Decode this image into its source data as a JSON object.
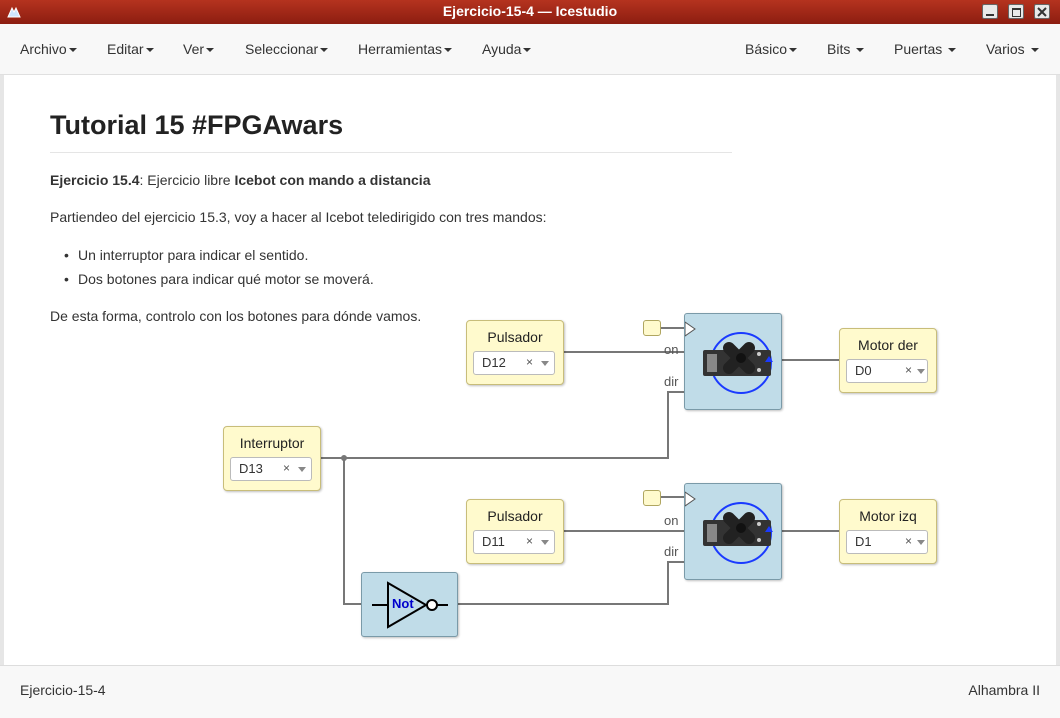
{
  "window": {
    "title": "Ejercicio-15-4 — Icestudio"
  },
  "menu_left": [
    {
      "label": "Archivo"
    },
    {
      "label": "Editar"
    },
    {
      "label": "Ver"
    },
    {
      "label": "Seleccionar"
    },
    {
      "label": "Herramientas"
    },
    {
      "label": "Ayuda"
    }
  ],
  "menu_right": [
    {
      "label": "Básico"
    },
    {
      "label": "Bits"
    },
    {
      "label": "Puertas"
    },
    {
      "label": "Varios"
    }
  ],
  "doc": {
    "heading": "Tutorial 15 #FPGAwars",
    "ex_label": "Ejercicio 15.4",
    "ex_mid": ": Ejercicio libre ",
    "ex_bold": "Icebot con mando a distancia",
    "intro": "Partiendeo del ejercicio 15.3, voy a hacer al Icebot teledirigido con tres mandos:",
    "bullets": [
      "Un interruptor para indicar el sentido.",
      "Dos botones para indicar qué motor se moverá."
    ],
    "outro": "De esta forma, controlo con los botones para dónde vamos."
  },
  "circuit": {
    "pulsador1": {
      "title": "Pulsador",
      "pin": "D12"
    },
    "pulsador2": {
      "title": "Pulsador",
      "pin": "D11"
    },
    "interruptor": {
      "title": "Interruptor",
      "pin": "D13"
    },
    "motor_der": {
      "title": "Motor der",
      "pin": "D0"
    },
    "motor_izq": {
      "title": "Motor izq",
      "pin": "D1"
    },
    "not_label": "Not",
    "port_on": "on",
    "port_dir": "dir",
    "clear_symbol": "×"
  },
  "status": {
    "left": "Ejercicio-15-4",
    "right": "Alhambra II"
  },
  "colors": {
    "titlebar": "#a8281a",
    "block_yellow": "#fffacd",
    "block_blue": "#c0dce8",
    "not_text": "#0000cc"
  }
}
